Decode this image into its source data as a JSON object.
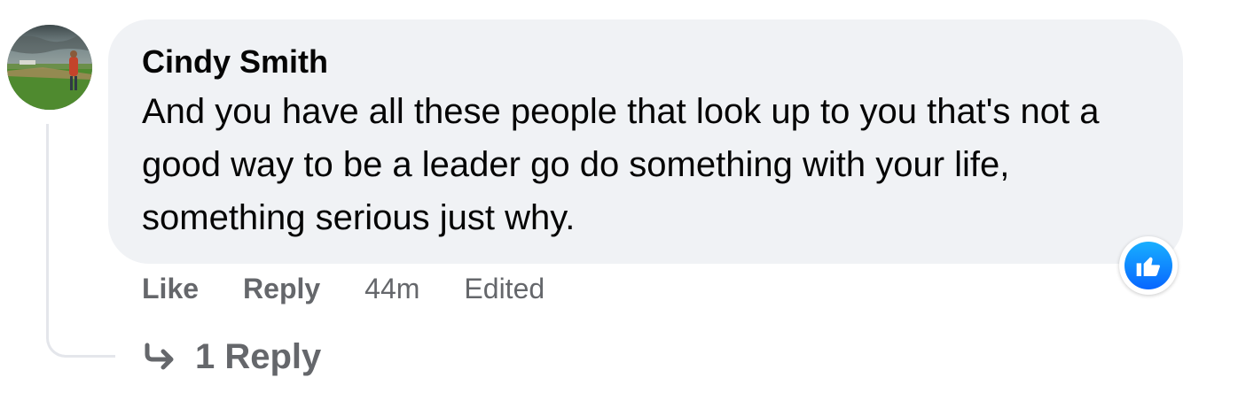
{
  "comment": {
    "author": "Cindy Smith",
    "text": "And you have all these people that look up to you that's not a good way to be a leader go do something with your life, something serious just why.",
    "avatar_icon": "profile-photo-landscape",
    "reaction_icon": "thumbs-up-icon",
    "reaction_color": "#0866ff",
    "bubble_color": "#f0f2f5"
  },
  "actions": {
    "like_label": "Like",
    "reply_label": "Reply",
    "time": "44m",
    "edited_label": "Edited"
  },
  "replies": {
    "icon": "reply-arrow-icon",
    "label": "1 Reply"
  }
}
